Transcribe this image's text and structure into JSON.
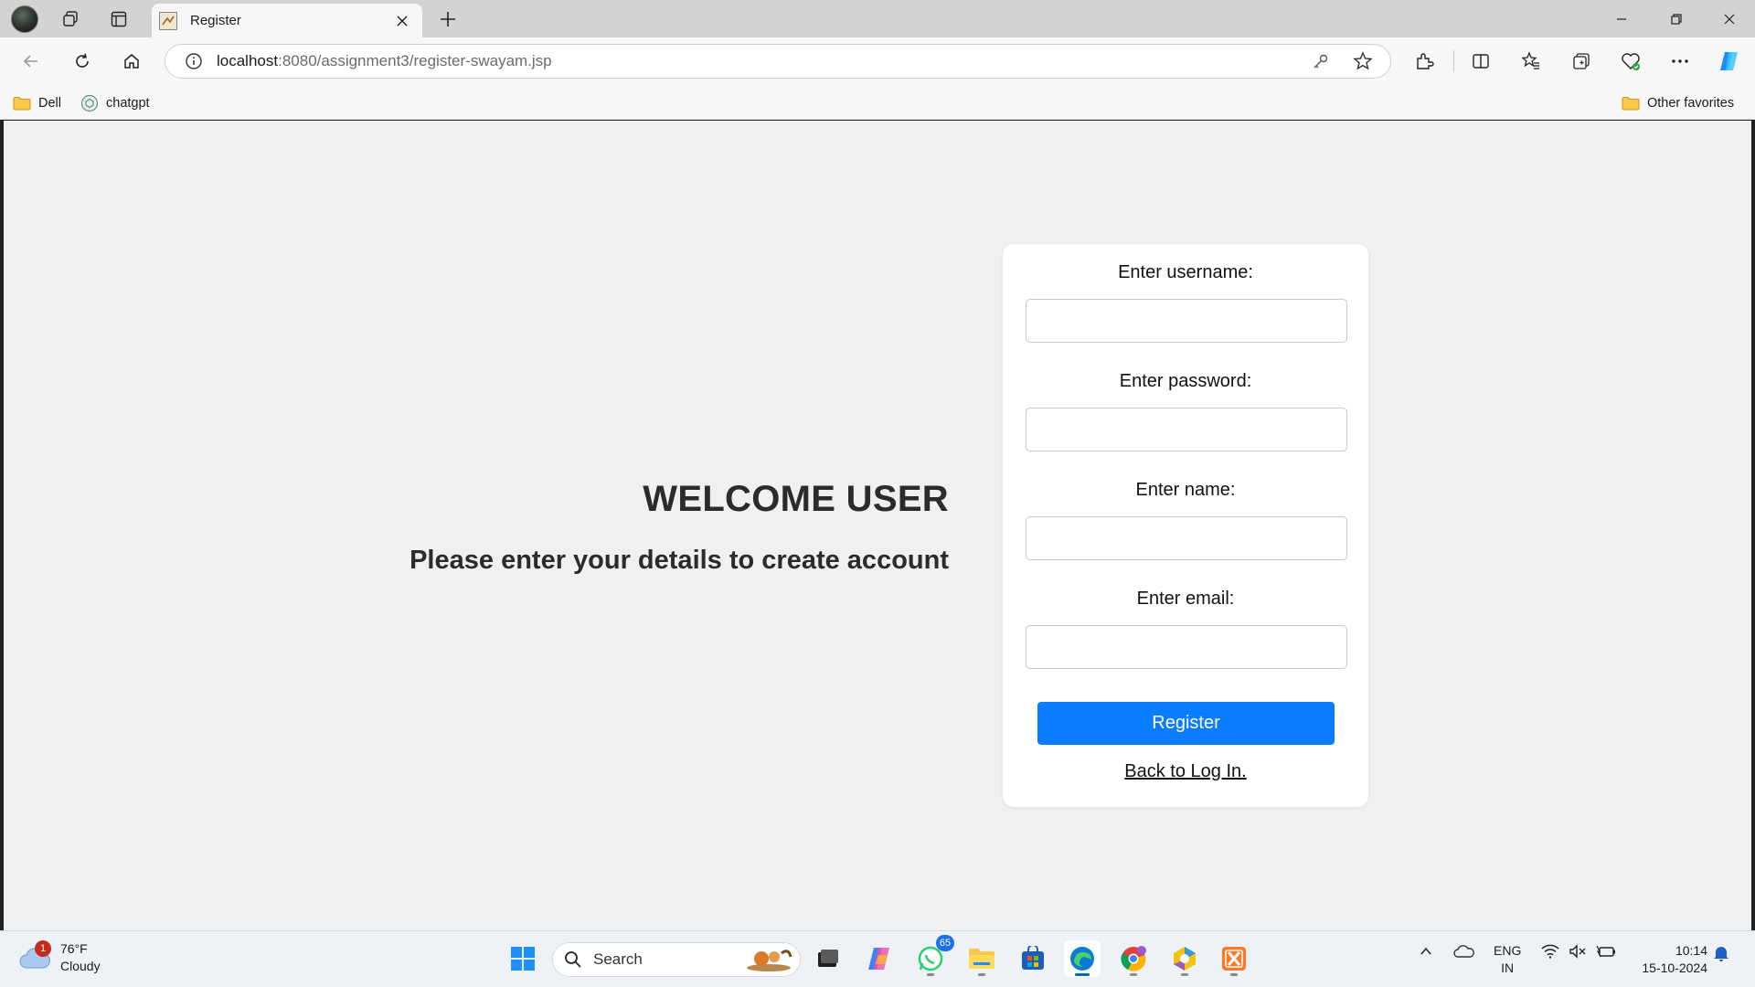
{
  "browser": {
    "tab_title": "Register",
    "url_host": "localhost",
    "url_rest": ":8080/assignment3/register-swayam.jsp",
    "favorites": [
      {
        "label": "Dell",
        "icon": "folder-icon"
      },
      {
        "label": "chatgpt",
        "icon": "chatgpt-icon"
      }
    ],
    "other_favorites": "Other favorites"
  },
  "page": {
    "heading": "WELCOME USER",
    "subheading": "Please enter your details to create account",
    "form": {
      "username_label": "Enter username:",
      "password_label": "Enter password:",
      "name_label": "Enter name:",
      "email_label": "Enter email:",
      "username_value": "",
      "password_value": "",
      "name_value": "",
      "email_value": "",
      "register_label": "Register",
      "back_label": "Back to Log In."
    },
    "colors": {
      "background": "#f0f0f0",
      "button": "#0a7cff",
      "card": "#ffffff"
    }
  },
  "taskbar": {
    "weather_temp": "76°F",
    "weather_desc": "Cloudy",
    "weather_badge": "1",
    "search_label": "Search",
    "whatsapp_badge": "65",
    "lang_top": "ENG",
    "lang_bottom": "IN",
    "time": "10:14",
    "date": "15-10-2024"
  }
}
